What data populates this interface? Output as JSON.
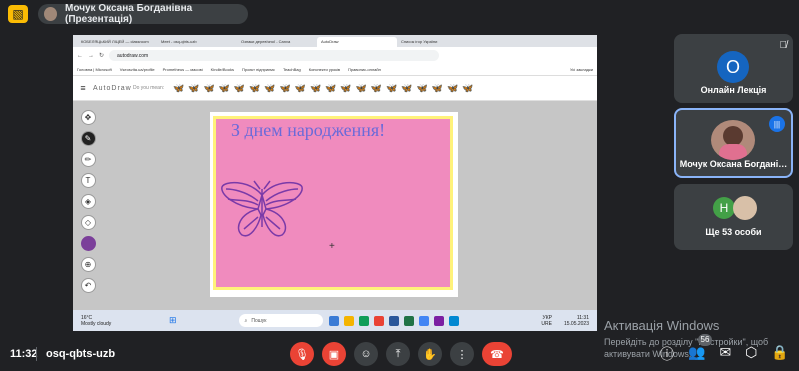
{
  "topbar": {
    "presenter_label": "Мочук Оксана Богданівна (Презентація)"
  },
  "browser": {
    "tabs": [
      "КОБЕЛЯЦЬКИЙ ЛІЦЕЙ — classroom",
      "Meet - osq-qbts-uzb",
      "Ознаки дерев'яної - Canva",
      "AutoDraw",
      "Список ігор України"
    ],
    "url": "autodraw.com",
    "bookmarks": [
      "Головна | Microsoft",
      "Vseosvita.ua/profile",
      "Prometheus — масові",
      "Kindle/Books",
      "Проєкт підприємс",
      "TeachBag",
      "Конспекти уроків",
      "Правопис-онлайн"
    ],
    "bookmark_all": "Усі закладки"
  },
  "autodraw": {
    "logo": "AutoDraw",
    "did_you_mean": "Do you mean:",
    "suggestions": [
      "🦋",
      "🦋",
      "🦋",
      "🦋",
      "🦋",
      "🦋",
      "🦋",
      "🦋",
      "🦋",
      "🦋",
      "🦋",
      "🦋",
      "🦋",
      "🦋",
      "🦋",
      "🦋",
      "🦋",
      "🦋",
      "🦋",
      "🦋"
    ]
  },
  "card": {
    "title": "З днем народження!"
  },
  "taskbar": {
    "weather_temp": "16°C",
    "weather_text": "Mostly cloudy",
    "search": "Пошук",
    "lang": "УКР",
    "lang2": "URE",
    "time": "11:31",
    "date": "15.05.2023"
  },
  "participants": [
    {
      "initial": "О",
      "name": "Онлайн Лекція",
      "color": "#1565c0"
    },
    {
      "name": "Мочук Оксана Богдані…"
    },
    {
      "initial": "Н",
      "name": "Ще 53 особи",
      "color": "#43a047"
    }
  ],
  "watermark": {
    "title": "Активація Windows",
    "line1": "Перейдіть до розділу \"Настройки\", щоб",
    "line2": "активувати Windows."
  },
  "bottom": {
    "time": "11:32",
    "code": "osq-qbts-uzb",
    "people_count": "56"
  }
}
